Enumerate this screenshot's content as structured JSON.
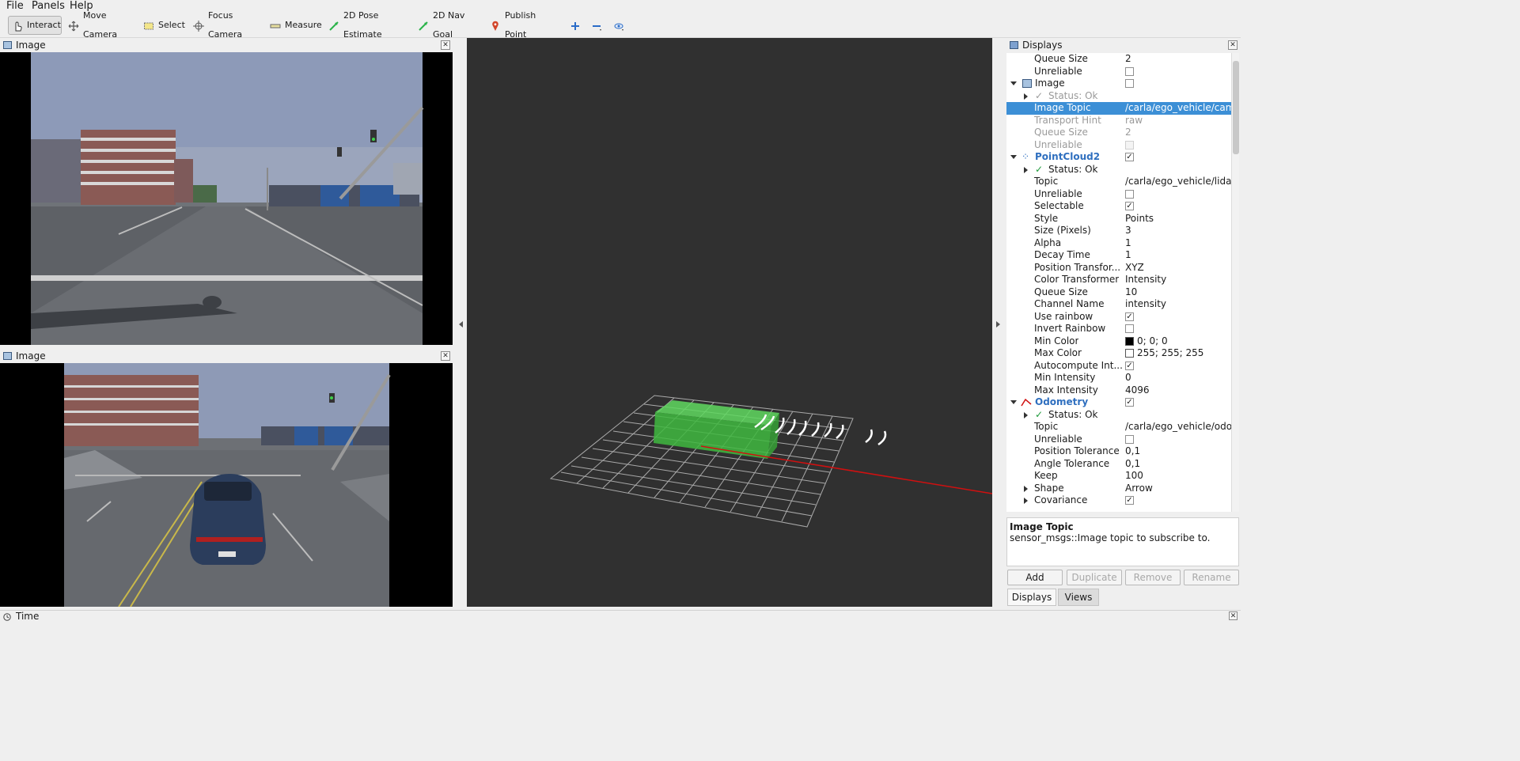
{
  "menu": {
    "file": "File",
    "panels": "Panels",
    "help": "Help"
  },
  "toolbar": {
    "interact": "Interact",
    "move_camera": "Move Camera",
    "select": "Select",
    "focus_camera": "Focus Camera",
    "measure": "Measure",
    "pose_estimate": "2D Pose Estimate",
    "nav_goal": "2D Nav Goal",
    "publish_point": "Publish Point"
  },
  "image_panel_top": {
    "title": "Image"
  },
  "image_panel_bottom": {
    "title": "Image"
  },
  "displays_panel": {
    "title": "Displays",
    "rows": [
      {
        "key": "Queue Size",
        "value": "2"
      },
      {
        "key": "Unreliable",
        "value": ""
      },
      {
        "key": "Image",
        "value": ""
      },
      {
        "key": "Status: Ok",
        "value": ""
      },
      {
        "key": "Image Topic",
        "value": "/carla/ego_vehicle/cam..."
      },
      {
        "key": "Transport Hint",
        "value": "raw"
      },
      {
        "key": "Queue Size",
        "value": "2"
      },
      {
        "key": "Unreliable",
        "value": ""
      },
      {
        "key": "PointCloud2",
        "value": ""
      },
      {
        "key": "Status: Ok",
        "value": ""
      },
      {
        "key": "Topic",
        "value": "/carla/ego_vehicle/lida..."
      },
      {
        "key": "Unreliable",
        "value": ""
      },
      {
        "key": "Selectable",
        "value": ""
      },
      {
        "key": "Style",
        "value": "Points"
      },
      {
        "key": "Size (Pixels)",
        "value": "3"
      },
      {
        "key": "Alpha",
        "value": "1"
      },
      {
        "key": "Decay Time",
        "value": "1"
      },
      {
        "key": "Position Transfor...",
        "value": "XYZ"
      },
      {
        "key": "Color Transformer",
        "value": "Intensity"
      },
      {
        "key": "Queue Size",
        "value": "10"
      },
      {
        "key": "Channel Name",
        "value": "intensity"
      },
      {
        "key": "Use rainbow",
        "value": ""
      },
      {
        "key": "Invert Rainbow",
        "value": ""
      },
      {
        "key": "Min Color",
        "value": "0; 0; 0"
      },
      {
        "key": "Max Color",
        "value": "255; 255; 255"
      },
      {
        "key": "Autocompute Int...",
        "value": ""
      },
      {
        "key": "Min Intensity",
        "value": "0"
      },
      {
        "key": "Max Intensity",
        "value": "4096"
      },
      {
        "key": "Odometry",
        "value": ""
      },
      {
        "key": "Status: Ok",
        "value": ""
      },
      {
        "key": "Topic",
        "value": "/carla/ego_vehicle/odo..."
      },
      {
        "key": "Unreliable",
        "value": ""
      },
      {
        "key": "Position Tolerance",
        "value": "0,1"
      },
      {
        "key": "Angle Tolerance",
        "value": "0,1"
      },
      {
        "key": "Keep",
        "value": "100"
      },
      {
        "key": "Shape",
        "value": "Arrow"
      },
      {
        "key": "Covariance",
        "value": ""
      }
    ],
    "description_title": "Image Topic",
    "description_text": "sensor_msgs::Image topic to subscribe to.",
    "buttons": {
      "add": "Add",
      "duplicate": "Duplicate",
      "remove": "Remove",
      "rename": "Rename"
    },
    "tabs": {
      "displays": "Displays",
      "views": "Views"
    }
  },
  "time_panel": {
    "title": "Time"
  },
  "colors": {
    "selection": "#3c8fd6",
    "viewport_bg": "#303030",
    "odometry_arrow": "#d01010",
    "ego_box": "#4fcf4f"
  }
}
